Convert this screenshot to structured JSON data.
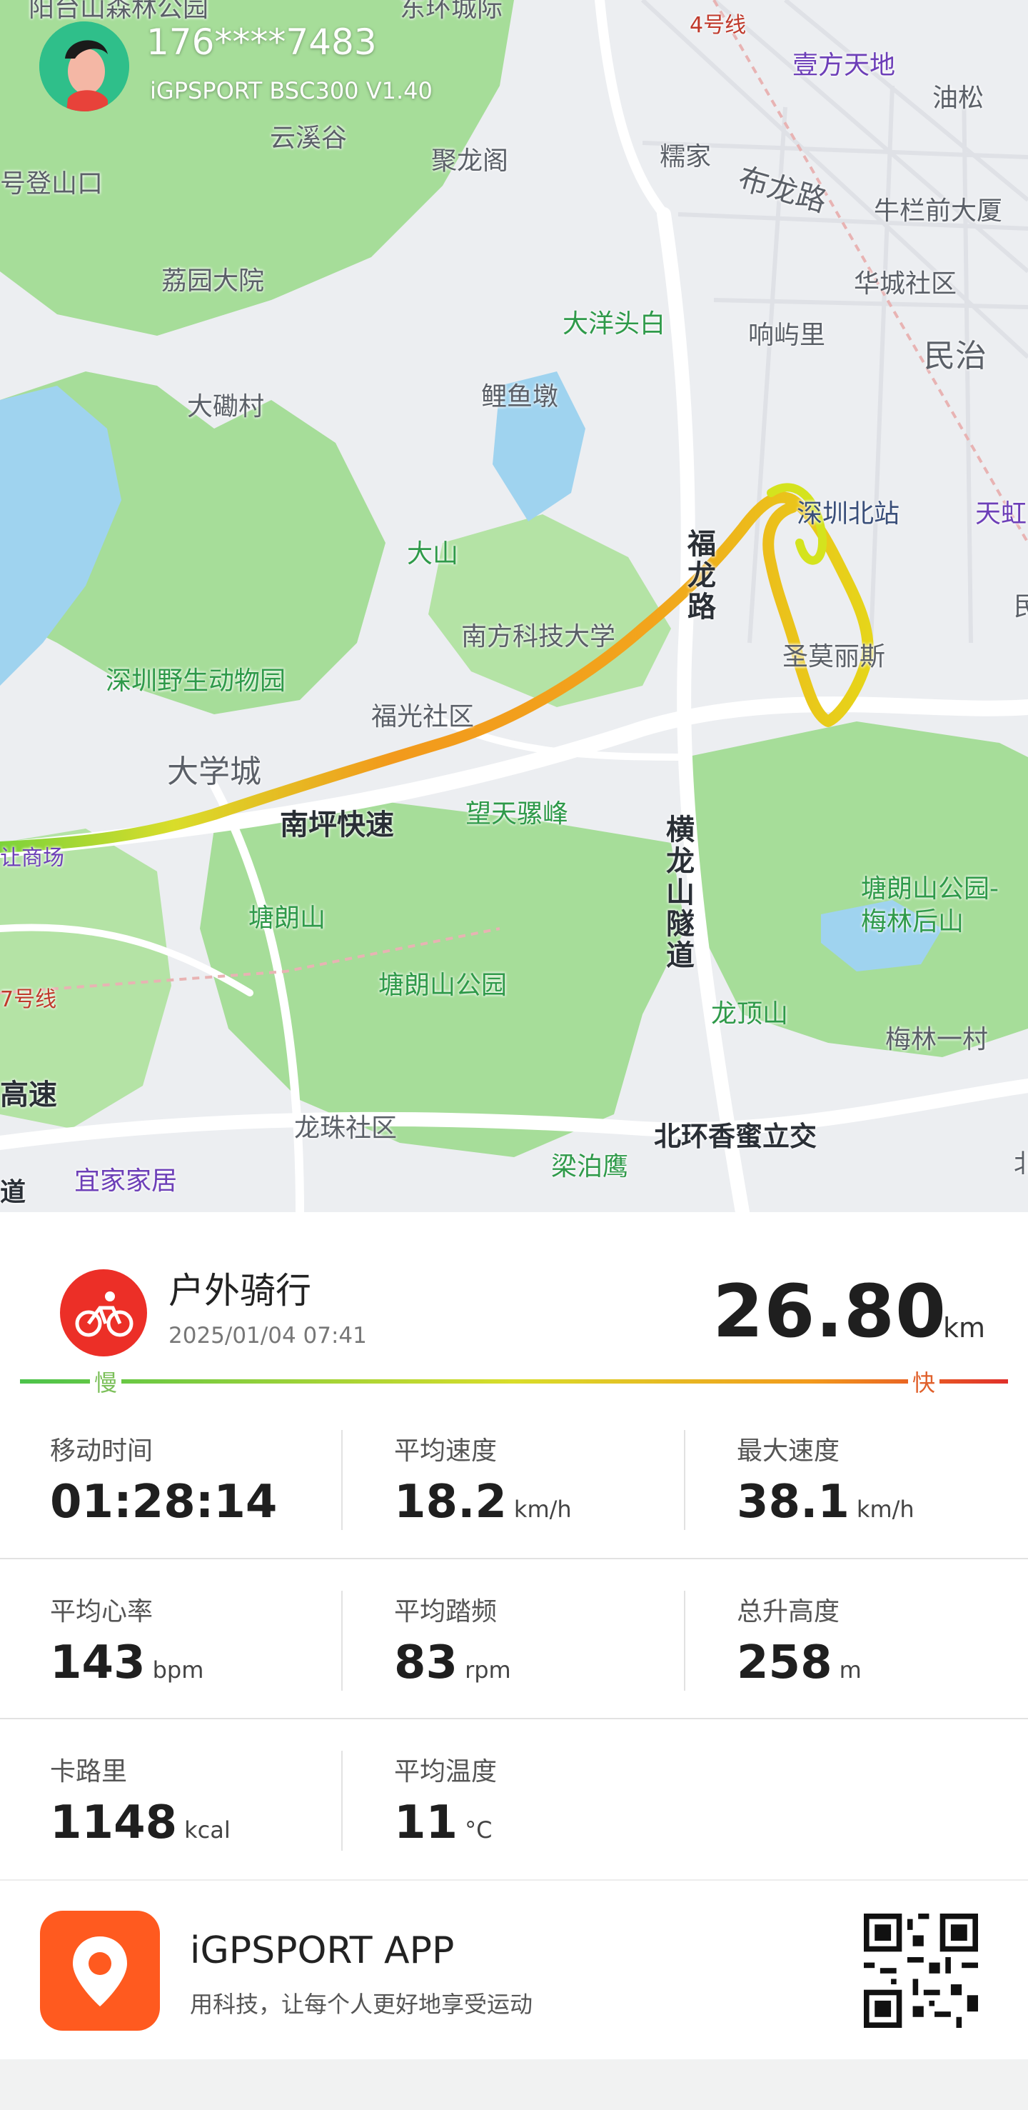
{
  "colors": {
    "accent_red": "#ec2f27",
    "app_orange": "#ff5a1f",
    "slow_green": "#4cc34b",
    "fast_red": "#e0302a",
    "park_green": "#a6dd99",
    "water_blue": "#9fd3ef"
  },
  "header": {
    "user_id": "176****7483",
    "device": "iGPSPORT BSC300   V1.40"
  },
  "map": {
    "labels": {
      "park_top": "阳台山森林公园",
      "east_station": "东环城际",
      "line4": "4号线",
      "yifang": "壹方天地",
      "youson": "油松",
      "yunxigu": "云溪谷",
      "julongge": "聚龙阁",
      "haodeng": "号登山口",
      "nuojia": "糯家",
      "bulong_road": "布龙路",
      "niulan": "牛栏前大厦",
      "liyuan": "荔园大院",
      "dayangtou": "大洋头白",
      "huacheng": "华城社区",
      "xiangxiuli": "响屿里",
      "minzhi": "民治",
      "daxiancun": "大磡村",
      "liyudun": "鲤鱼墩",
      "shenzhen_north": "深圳北站",
      "tianhong": "天虹",
      "dashan": "大山",
      "fulong_road": "福龙路",
      "sustech": "南方科技大学",
      "min_right": "民",
      "zoo": "深圳野生动物园",
      "shengmolisi": "圣莫丽斯",
      "fuguang": "福光社区",
      "daxuecheng": "大学城",
      "nanping": "南坪快速",
      "wangtian": "望天骡峰",
      "henglong": "横龙山隧道",
      "tanglang_park_right": "塘朗山公园-梅林后山",
      "tanglang": "塘朗山",
      "tanglang_park": "塘朗山公园",
      "longdingshan": "龙顶山",
      "meilin": "梅林一村",
      "line7": "7号线",
      "gaosu": "高速",
      "longzhu": "龙珠社区",
      "liangpoying": "梁泊鹰",
      "beihuan": "北环香蜜立交",
      "ikea": "宜家家居",
      "dao": "道",
      "shopping_left": "让商场",
      "bei_right": "北"
    }
  },
  "activity": {
    "title": "户外骑行",
    "date": "2025/01/04 07:41",
    "distance": "26.80",
    "distance_unit": "km",
    "slow_label": "慢",
    "fast_label": "快"
  },
  "stats": [
    {
      "label": "移动时间",
      "value": "01:28:14",
      "unit": ""
    },
    {
      "label": "平均速度",
      "value": "18.2",
      "unit": "km/h"
    },
    {
      "label": "最大速度",
      "value": "38.1",
      "unit": "km/h"
    },
    {
      "label": "平均心率",
      "value": "143",
      "unit": "bpm"
    },
    {
      "label": "平均踏频",
      "value": "83",
      "unit": "rpm"
    },
    {
      "label": "总升高度",
      "value": "258",
      "unit": "m"
    },
    {
      "label": "卡路里",
      "value": "1148",
      "unit": "kcal"
    },
    {
      "label": "平均温度",
      "value": "11",
      "unit": "°C"
    }
  ],
  "footer": {
    "app_name": "iGPSPORT APP",
    "slogan": "用科技，让每个人更好地享受运动"
  }
}
